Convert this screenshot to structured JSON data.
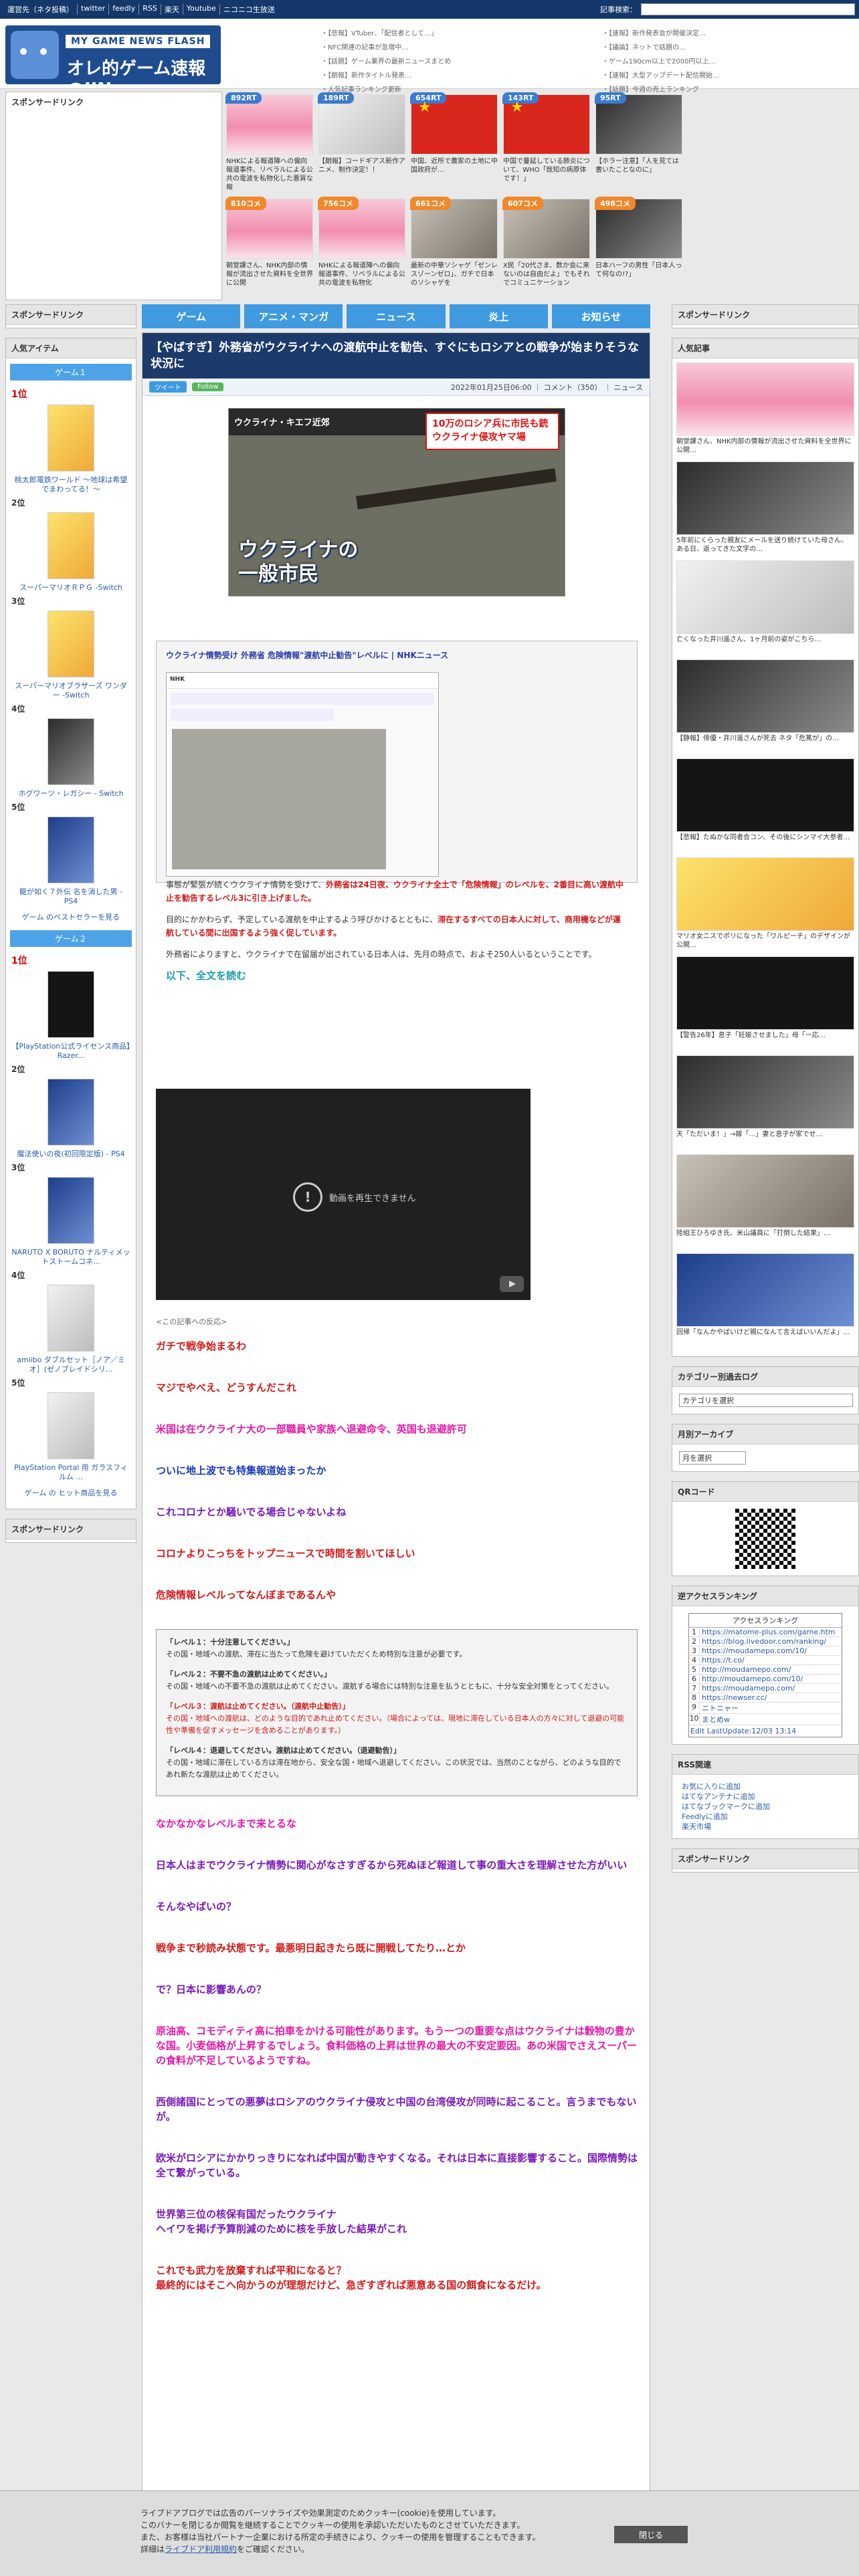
{
  "topbar": {
    "links": [
      "運営先（ネタ投稿）",
      "twitter",
      "feedly",
      "RSS",
      "楽天",
      "Youtube",
      "ニコニコ生放送"
    ],
    "search_label": "記事検索："
  },
  "header": {
    "logo_sub": "MY GAME NEWS FLASH",
    "logo_main": "オレ的ゲーム速報@JIN",
    "links_col1": [
      "【悲報】VTuber、「配信者として…」",
      "NFC関連の記事が急増中…",
      "【話題】ゲーム業界の最新ニュースまとめ",
      "【朗報】新作タイトル発表…",
      "人気記事ランキング更新"
    ],
    "links_col2": [
      "【速報】新作発表会が開催決定…",
      "【議論】ネットで話題の…",
      "ゲーム190cm以上で2000円以上…",
      "【速報】大型アップデート配信開始…",
      "【話題】今週の売上ランキング"
    ]
  },
  "sponsor_label": "スポンサードリンク",
  "thumbs": [
    {
      "count": "892RT",
      "caption": "NHKによる報道陣への偏向報道事件、リベラルによる公共の電波を私物化した悪質な報",
      "style": "pinkhair",
      "orange": false
    },
    {
      "count": "189RT",
      "caption": "【朗報】コードギアス新作アニメ、制作決定！！",
      "style": "photo3",
      "orange": false
    },
    {
      "count": "654RT",
      "caption": "中国、近所で農家の土地に中国政府が…",
      "style": "flag",
      "orange": false
    },
    {
      "count": "143RT",
      "caption": "中国で蔓延している肺炎について、WHO「既知の病原体です！」",
      "style": "flag",
      "orange": false
    },
    {
      "count": "95RT",
      "caption": "【ホラー注意】「人を見ては書いたことなのに」",
      "style": "photo2",
      "orange": false
    },
    {
      "count": "810コメ",
      "caption": "朝堂課さん、NHK内部の情報が流出させた資料を全世界に公開",
      "style": "pinkhair",
      "orange": true
    },
    {
      "count": "756コメ",
      "caption": "NHKによる報道陣への偏向報道事件、リベラルによる公共の電波を私物化",
      "style": "pinkhair",
      "orange": true
    },
    {
      "count": "661コメ",
      "caption": "最新の中華ソシャゲ「ゼンレスゾーンゼロ」、ガチで日本のソシャゲを",
      "style": "photo1",
      "orange": true
    },
    {
      "count": "607コメ",
      "caption": "X民「20代さま、数か会に来ないのは自由だよ」でもそれでコミュニケーション",
      "style": "photo1",
      "orange": true
    },
    {
      "count": "498コメ",
      "caption": "日本ハーフの男性「日本人って何なの!?」",
      "style": "photo2",
      "orange": true
    }
  ],
  "nav": [
    "ゲーム",
    "アニメ・マンガ",
    "ニュース",
    "炎上",
    "お知らせ"
  ],
  "left": {
    "popular_title": "人気アイテム",
    "game1_title": "ゲーム１",
    "game1": [
      {
        "rank": "1位",
        "name": "桃太郎電鉄ワールド ～地球は希望でまわってる！～",
        "style": "yellow"
      },
      {
        "rank": "2位",
        "name": "スーパーマリオＲＰＧ -Switch",
        "style": "yellow"
      },
      {
        "rank": "3位",
        "name": "スーパーマリオブラザーズ ワンダー -Switch",
        "style": "yellow"
      },
      {
        "rank": "4位",
        "name": "ホグワーツ・レガシー - Switch",
        "style": "photo2"
      },
      {
        "rank": "5位",
        "name": "龍が如く７外伝 名を消した男 - PS4",
        "style": "blue2"
      }
    ],
    "game1_more": "ゲーム のベストセラーを見る",
    "game2_title": "ゲーム２",
    "game2": [
      {
        "rank": "1位",
        "name": "【PlayStation公式ライセンス商品】Razer...",
        "style": "dark"
      },
      {
        "rank": "2位",
        "name": "魔法使いの夜(初回限定版) - PS4",
        "style": "blue2"
      },
      {
        "rank": "3位",
        "name": "NARUTO X BORUTO ナルティメットストームコネ...",
        "style": "blue2"
      },
      {
        "rank": "4位",
        "name": "amiibo ダブルセット［ノア／ミオ］(ゼノブレイドシリ...",
        "style": "photo3"
      },
      {
        "rank": "5位",
        "name": "PlayStation Portal 用 ガラスフィルム ...",
        "style": "photo3"
      }
    ],
    "game2_more": "ゲーム の ヒット商品を見る",
    "sponsor_bottom": "スポンサードリンク"
  },
  "article": {
    "title": "【やばすぎ】外務省がウクライナへの渡航中止を勧告、すぐにもロシアとの戦争が始まりそうな状況に",
    "tweet_btn": "ツイート",
    "follow_btn": "Follow",
    "meta": "2022年01月25日06:00 ｜ コメント（350） ｜ ニュース",
    "hero_headline": "ウクライナ・キエフ近郊",
    "hero_red": "10万のロシア兵に市民も銃 ウクライナ侵攻ヤマ場",
    "hero_caption_1": "ウクライナの",
    "hero_caption_2": "一般市民",
    "quote_title": "ウクライナ情勢受け 外務省 危険情報\"渡航中止勧告\"レベルに | NHKニュース",
    "nhk_logo": "NHK",
    "quote_p1_a": "事態が緊張が続くウクライナ情勢を受けて、",
    "quote_p1_b": "外務省は24日夜、ウクライナ全土で「危険情報」のレベルを、2番目に高い渡航中止を勧告するレベル3に引き上げました。",
    "quote_p2_a": "目的にかかわらず、予定している渡航を中止するよう呼びかけるとともに、",
    "quote_p2_b": "滞在するすべての日本人に対して、商用機などが運航している間に出国するよう強く促しています。",
    "quote_p3": "外務省によりますと、ウクライナで在留届が出されている日本人は、先月の時点で、およそ250人いるということです。",
    "read_more": "以下、全文を読む",
    "video_msg": "動画を再生できません",
    "comments_lead": "<この記事への反応>",
    "comments_a": [
      {
        "text": "ガチで戦争始まるわ",
        "color": "red"
      },
      {
        "text": "マジでやべえ、どうすんだこれ",
        "color": "red"
      },
      {
        "text": "米国は在ウクライナ大の一部職員や家族へ退避命令、英国も退避許可",
        "color": "mag"
      },
      {
        "text": "ついに地上波でも特集報道始まったか",
        "color": "blue"
      },
      {
        "text": "これコロナとか騒いでる場合じゃないよね",
        "color": "purple"
      },
      {
        "text": "コロナよりこっちをトップニュースで時間を割いてほしい",
        "color": "red"
      },
      {
        "text": "危険情報レベルってなんぼまであるんや",
        "color": "red"
      }
    ],
    "warn": [
      {
        "head": "「レベル１：十分注意してください。」",
        "body": "その国・地域への渡航、滞在に当たって危険を避けていただくため特別な注意が必要です。",
        "red": false
      },
      {
        "head": "「レベル２：不要不急の渡航は止めてください。」",
        "body": "その国・地域への不要不急の渡航は止めてください。渡航する場合には特別な注意を払うとともに、十分な安全対策をとってください。",
        "red": false
      },
      {
        "head": "「レベル３：渡航は止めてください。（渡航中止勧告）」",
        "body": "その国・地域への渡航は、どのような目的であれ止めてください。（場合によっては、現地に滞在している日本人の方々に対して退避の可能性や準備を促すメッセージを含めることがあります。）",
        "red": true
      },
      {
        "head": "「レベル４：退避してください。渡航は止めてください。（退避勧告）」",
        "body": "その国・地域に滞在している方は滞在地から、安全な国・地域へ退避してください。この状況では、当然のことながら、どのような目的であれ新たな渡航は止めてください。",
        "red": false
      }
    ],
    "comments_b": [
      {
        "text": "なかなかなレベルまで来とるな",
        "color": "mag"
      },
      {
        "text": "日本人はまでウクライナ情勢に関心がなさすぎるから死ぬほど報道して事の重大さを理解させた方がいい",
        "color": "purple"
      },
      {
        "text": "そんなやばいの？",
        "color": "purple"
      },
      {
        "text": "戦争まで秒読み状態です。最悪明日起きたら既に開戦してたり…とか",
        "color": "red"
      },
      {
        "text": "で？日本に影響あんの？",
        "color": "purple"
      },
      {
        "text": "原油高、コモディティ高に拍車をかける可能性があります。もう一つの重要な点はウクライナは穀物の豊かな国。小麦価格が上昇するでしょう。食料価格の上昇は世界の最大の不安定要因。あの米国でさえスーパーの食料が不足しているようですね。",
        "color": "mag"
      },
      {
        "text": "西側諸国にとっての悪夢はロシアのウクライナ侵攻と中国の台湾侵攻が同時に起こること。言うまでもないが。",
        "color": "purple"
      },
      {
        "text": "欧米がロシアにかかりっきりになれば中国が動きやすくなる。それは日本に直接影響すること。国際情勢は全て繋がっている。",
        "color": "purple"
      },
      {
        "text": "世界第三位の核保有国だったウクライナ\nヘイワを掲げ予算削減のために核を手放した結果がこれ",
        "color": "purple"
      },
      {
        "text": "これでも武力を放棄すれば平和になると？\n最終的にはそこへ向かうのが理想だけど、急ぎすぎれば悪意ある国の餌食になるだけ。",
        "color": "red"
      }
    ]
  },
  "right": {
    "sponsor": "スポンサードリンク",
    "popular_title": "人気記事",
    "popular": [
      {
        "caption": "朝堂課さん、NHK内部の情報が流出させた資料を全世界に公開…",
        "style": "pinkhair"
      },
      {
        "caption": "5年前にくらった親友にメールを送り続けていた母さん、ある日、返ってきた文字の…",
        "style": "photo2"
      },
      {
        "caption": "亡くなった井川遥さん、1ヶ月前の姿がこちら…",
        "style": "photo3"
      },
      {
        "caption": "【静報】俳優・井川遥さんが死去 ネタ「危篤が」の…",
        "style": "photo2"
      },
      {
        "caption": "【悲報】たぬかな同者合コン、その後にシンマイ大参者…",
        "style": "dark"
      },
      {
        "caption": "マリオ女ニスでポリになった「ワルピーチ」のデザインが公開…",
        "style": "yellow"
      },
      {
        "caption": "【警告26年】息子「妊娠させました」母「一応…",
        "style": "dark"
      },
      {
        "caption": "天「ただいま！」→嫁「…」妻と息子が家でせ…",
        "style": "photo2"
      },
      {
        "caption": "陸組王ひろゆき氏、米山議員に「打倒した結果」…",
        "style": "photo1"
      },
      {
        "caption": "回帰「なんかやばいけど親になんて言えばいいんだよ」…",
        "style": "blue2"
      }
    ],
    "category_title": "カテゴリー別過去ログ",
    "category_select": "カテゴリを選択",
    "archive_title": "月別アーカイブ",
    "archive_select": "月を選択",
    "qr_title": "QRコード",
    "acc_title": "逆アクセスランキング",
    "acc_head": "アクセスランキング",
    "acc_rows": [
      "https://matome-plus.com/game.htm",
      "https://blog.livedoor.com/ranking/",
      "https://moudamepo.com/10/",
      "https://t.co/",
      "http://moudamepo.com/",
      "http://moudamepo.com/10/",
      "https://moudamepo.com/",
      "https://newser.cc/",
      "ニトニャー",
      "まとめw"
    ],
    "acc_footer": "Edit LastUpdate:12/03 13:14",
    "rss_title": "RSS関連",
    "rss_links": [
      "お気に入りに追加",
      "はてなアンテナに追加",
      "はてなブックマークに追加",
      "Feedlyに追加",
      "楽天市場"
    ],
    "sponsor2": "スポンサードリンク"
  },
  "cookie": {
    "line1": "ライブドアブログでは広告のパーソナライズや効果測定のためクッキー(cookie)を使用しています。",
    "line2": "このバナーを閉じるか閲覧を継続することでクッキーの使用を承認いただいたものとさせていただきます。",
    "line3": "また、お客様は当社パートナー企業における所定の手続きにより、クッキーの使用を管理することもできます。",
    "line4_a": "詳細は",
    "line4_link": "ライブドア利用規約",
    "line4_b": "をご確認ください。",
    "close": "閉じる"
  }
}
